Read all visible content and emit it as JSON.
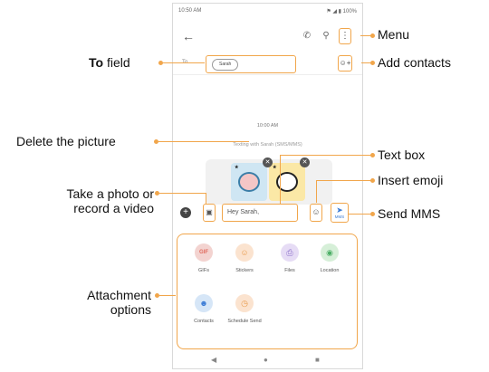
{
  "phone": {
    "status": {
      "time": "10:50 AM",
      "indicators": "⚑ ◢ ▮ 100%"
    },
    "to_label": "To",
    "recipient_chip": "Sarah",
    "timestamp": "10:00 AM",
    "mode_text": "Texting with Sarah (SMS/MMS)",
    "textbox_value": "Hey Sarah,",
    "send_label": "MMS",
    "attachments": [
      {
        "label": "GIFs",
        "icon": "gif-icon",
        "color": "#f3d3d0",
        "glyph": "GIF",
        "glyph_color": "#e06b5f"
      },
      {
        "label": "Stickers",
        "icon": "sticker-icon",
        "color": "#fbe3cf",
        "glyph": "☺",
        "glyph_color": "#e89a4a"
      },
      {
        "label": "Files",
        "icon": "paperclip-icon",
        "color": "#e6dcf5",
        "glyph": "⎘",
        "glyph_color": "#8a6cc9"
      },
      {
        "label": "Location",
        "icon": "location-pin-icon",
        "color": "#d6efd8",
        "glyph": "◉",
        "glyph_color": "#4caf66"
      },
      {
        "label": "Contacts",
        "icon": "contact-icon",
        "color": "#d6e6f7",
        "glyph": "☻",
        "glyph_color": "#3a7bd5"
      },
      {
        "label": "Schedule Send",
        "icon": "clock-icon",
        "color": "#fbe3cf",
        "glyph": "◷",
        "glyph_color": "#e89a4a"
      }
    ]
  },
  "callouts": {
    "menu": "Menu",
    "to_field_bold": "To",
    "to_field_rest": " field",
    "add_contacts": "Add contacts",
    "delete_picture": "Delete the picture",
    "text_box": "Text box",
    "take_photo_1": "Take a photo or",
    "take_photo_2": "record a video",
    "insert_emoji": "Insert emoji",
    "send_mms": "Send MMS",
    "attachment_1": "Attachment",
    "attachment_2": "options"
  },
  "colors": {
    "callout_accent": "#f1a64b",
    "send_blue": "#3a7bd5"
  }
}
